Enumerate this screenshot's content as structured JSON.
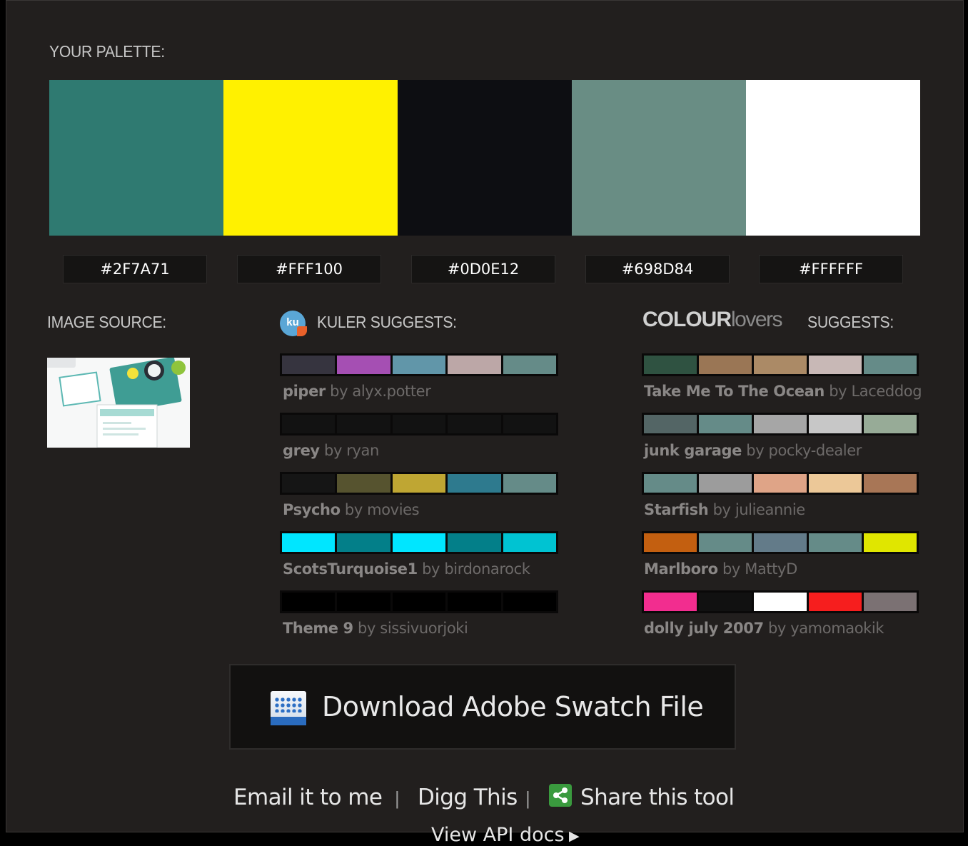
{
  "palette": {
    "title": "YOUR PALETTE:",
    "colors": [
      {
        "hex": "#2F7A71",
        "label": "#2F7A71"
      },
      {
        "hex": "#FFF100",
        "label": "#FFF100"
      },
      {
        "hex": "#0D0E12",
        "label": "#0D0E12"
      },
      {
        "hex": "#698D84",
        "label": "#698D84"
      },
      {
        "hex": "#FFFFFF",
        "label": "#FFFFFF"
      }
    ]
  },
  "image_source": {
    "title": "IMAGE SOURCE:"
  },
  "kuler": {
    "title": "KULER SUGGESTS:",
    "logo_text": "ku",
    "themes": [
      {
        "name": "piper",
        "by": "by",
        "author": "alyx.potter",
        "colors": [
          "#36343f",
          "#a54fb3",
          "#6196a9",
          "#bca7a7",
          "#658b88"
        ]
      },
      {
        "name": "grey",
        "by": "by",
        "author": "ryan",
        "colors": [
          "#121212",
          "#121212",
          "#121212",
          "#121212",
          "#121212"
        ]
      },
      {
        "name": "Psycho",
        "by": "by",
        "author": "movies",
        "colors": [
          "#151515",
          "#56532f",
          "#bfa633",
          "#2e7a8e",
          "#658b88"
        ]
      },
      {
        "name": "ScotsTurquoise1",
        "by": "by",
        "author": "birdonarock",
        "colors": [
          "#00e6ff",
          "#037f89",
          "#00e6ff",
          "#037f89",
          "#00c3d2"
        ]
      },
      {
        "name": "Theme 9",
        "by": "by",
        "author": "sissivuorjoki",
        "colors": [
          "#000000",
          "#000000",
          "#000000",
          "#000000",
          "#000000"
        ]
      }
    ]
  },
  "colourlovers": {
    "logo_bold": "COLOUR",
    "logo_light": "lovers",
    "title": "SUGGESTS:",
    "themes": [
      {
        "name": "Take Me To The Ocean",
        "by": "by",
        "author": "Laceddog",
        "colors": [
          "#2f5241",
          "#9a7655",
          "#ab8a66",
          "#c8b8b6",
          "#658b88"
        ]
      },
      {
        "name": "junk garage",
        "by": "by",
        "author": "pocky-dealer",
        "colors": [
          "#536565",
          "#658b88",
          "#a6a6a6",
          "#c7c7c7",
          "#97ab97"
        ]
      },
      {
        "name": "Starfish",
        "by": "by",
        "author": "julieannie",
        "colors": [
          "#658b88",
          "#9c9c9c",
          "#dfa487",
          "#ecc898",
          "#a87656"
        ]
      },
      {
        "name": "Marlboro",
        "by": "by",
        "author": "MattyD",
        "colors": [
          "#c35f10",
          "#658b88",
          "#637b89",
          "#658b88",
          "#e0e600"
        ]
      },
      {
        "name": "dolly july 2007",
        "by": "by",
        "author": "yamomaokik",
        "colors": [
          "#f22d8f",
          "#111111",
          "#ffffff",
          "#f61e1e",
          "#7b7173"
        ]
      }
    ]
  },
  "download": {
    "label": "Download Adobe Swatch File",
    "icon_text": "SWATCH"
  },
  "footer": {
    "email": "Email it to me",
    "sep1": "|",
    "digg": "Digg This",
    "sep2": "|",
    "share": "Share this tool",
    "api": "View API docs",
    "api_arrow": "▶"
  }
}
